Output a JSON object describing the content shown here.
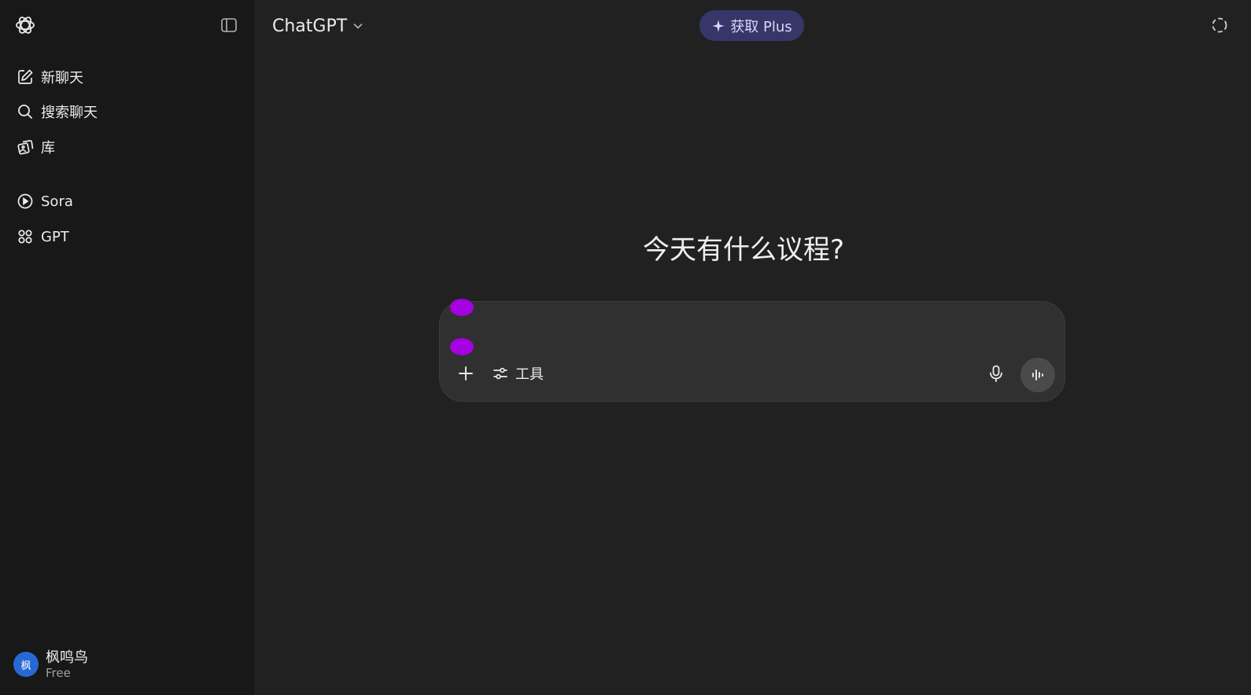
{
  "sidebar": {
    "logo": "openai-logo-icon",
    "collapse_icon": "sidebar-toggle-icon",
    "items": [
      {
        "label": "新聊天",
        "icon": "edit-icon"
      },
      {
        "label": "搜索聊天",
        "icon": "search-icon"
      },
      {
        "label": "库",
        "icon": "library-icon"
      },
      {
        "label": "Sora",
        "icon": "play-circle-icon"
      },
      {
        "label": "GPT",
        "icon": "grid-icon"
      }
    ],
    "user": {
      "avatar_text": "枫",
      "name": "枫鸣鸟",
      "plan": "Free",
      "avatar_color": "#2768d4"
    }
  },
  "header": {
    "model": "ChatGPT",
    "plus_button": "获取 Plus",
    "plus_color": "#373669",
    "temp_chat_icon": "dashed-circle-icon"
  },
  "main": {
    "headline": "今天有什么议程?",
    "composer": {
      "tools_label": "工具",
      "add_icon": "plus-icon",
      "tools_icon": "sliders-icon",
      "mic_icon": "microphone-icon",
      "voice_icon": "voice-waveform-icon",
      "accent_color": "#a400e0"
    }
  }
}
